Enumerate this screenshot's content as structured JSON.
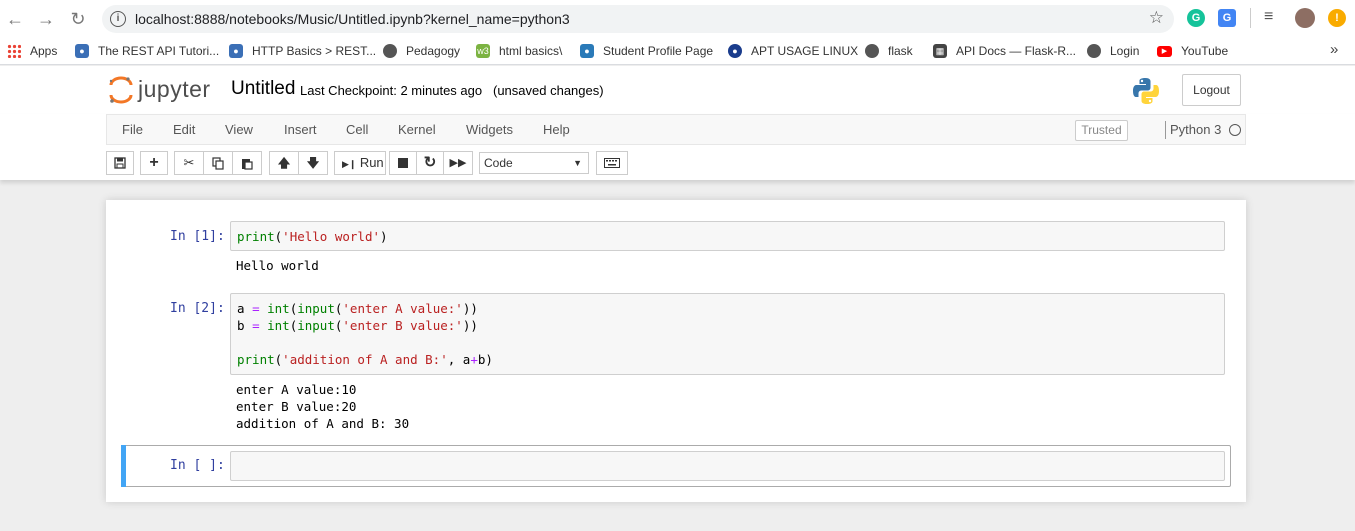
{
  "browser": {
    "url": "localhost:8888/notebooks/Music/Untitled.ipynb?kernel_name=python3",
    "bookmarks": [
      {
        "label": "Apps",
        "icon": "apps-grid-icon"
      },
      {
        "label": "The REST API Tutori...",
        "icon": "bookmark-favicon"
      },
      {
        "label": "HTTP Basics > REST...",
        "icon": "bookmark-favicon"
      },
      {
        "label": "Pedagogy",
        "icon": "globe-icon"
      },
      {
        "label": "html basics\\",
        "icon": "bookmark-favicon"
      },
      {
        "label": "Student Profile Page",
        "icon": "bookmark-favicon"
      },
      {
        "label": "APT USAGE LINUX",
        "icon": "bookmark-favicon"
      },
      {
        "label": "flask",
        "icon": "globe-icon"
      },
      {
        "label": "API Docs — Flask-R...",
        "icon": "bookmark-favicon"
      },
      {
        "label": "Login",
        "icon": "globe-icon"
      },
      {
        "label": "YouTube",
        "icon": "youtube-icon"
      }
    ],
    "more_bookmarks": "»"
  },
  "header": {
    "logo_text": "jupyter",
    "notebook_name": "Untitled",
    "checkpoint": "Last Checkpoint: 2 minutes ago",
    "autosave_status": "(unsaved changes)",
    "logout_label": "Logout"
  },
  "menubar": {
    "items": [
      "File",
      "Edit",
      "View",
      "Insert",
      "Cell",
      "Kernel",
      "Widgets",
      "Help"
    ],
    "trusted": "Trusted",
    "kernel": "Python 3"
  },
  "toolbar": {
    "run_label": "Run",
    "cell_type": "Code"
  },
  "cells": [
    {
      "prompt": "In [1]:",
      "output": "Hello world"
    },
    {
      "prompt": "In [2]:",
      "output": "enter A value:10\nenter B value:20\naddition of A and B: 30"
    },
    {
      "prompt": "In [ ]:",
      "output": ""
    }
  ],
  "colors": {
    "prompt": "#303f9f",
    "selected_cell_bar": "#42a5f5",
    "jupyter_orange": "#f37726"
  }
}
